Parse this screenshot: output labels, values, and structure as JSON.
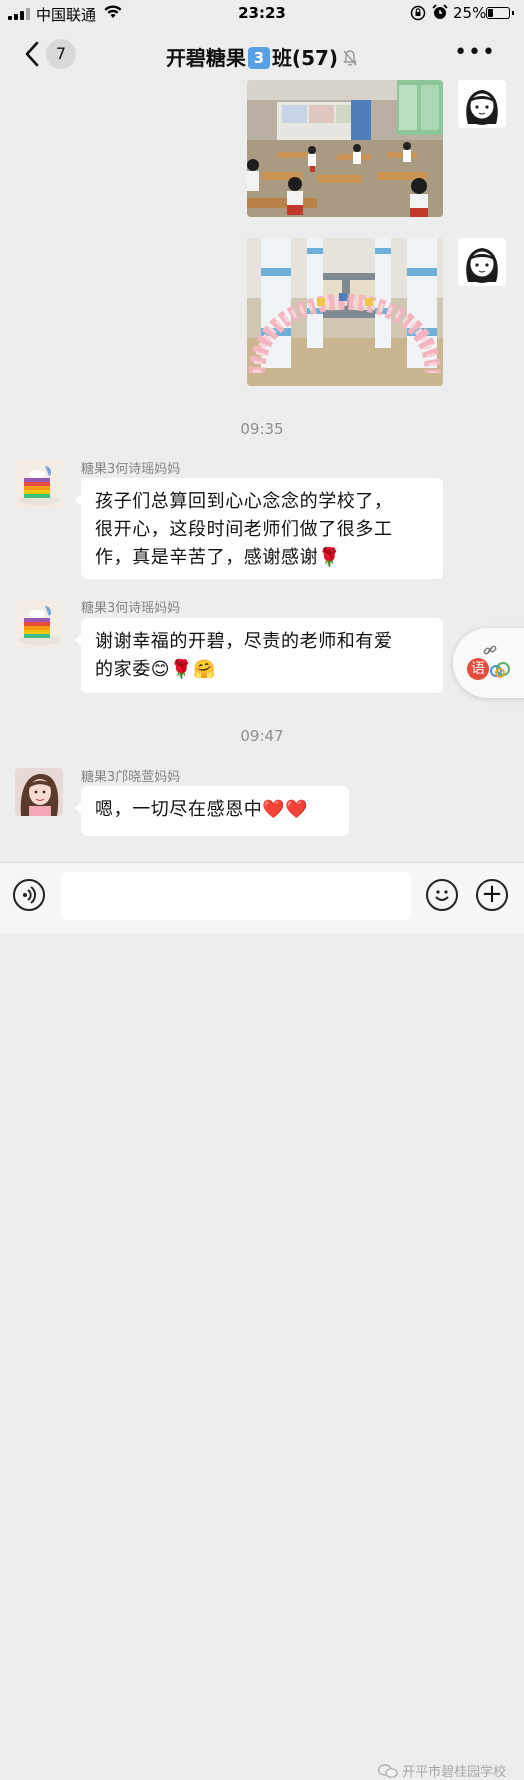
{
  "status_bar": {
    "carrier": "中国联通",
    "time": "23:23",
    "battery": "25%",
    "battery_level": 0.25
  },
  "nav": {
    "back_count": "7",
    "title_prefix": "开碧糖果",
    "title_keycap": "3",
    "title_suffix": "班(57)",
    "more_label": "•••"
  },
  "messages": [
    {
      "type": "image",
      "from": "me",
      "subject": "classroom"
    },
    {
      "type": "image",
      "from": "me",
      "subject": "balloon-arch"
    },
    {
      "type": "time",
      "text": "09:35"
    },
    {
      "type": "text",
      "sender": "糖果3何诗瑶妈妈",
      "lines": [
        "孩子们总算回到心心念念的学校了，",
        "很开心，这段时间老师们做了很多工",
        "作，真是辛苦了，感谢感谢🌹"
      ]
    },
    {
      "type": "text",
      "sender": "糖果3何诗瑶妈妈",
      "lines": [
        "谢谢幸福的开碧，尽责的老师和有爱",
        "的家委😊🌹🤗"
      ]
    },
    {
      "type": "time",
      "text": "09:47"
    },
    {
      "type": "text",
      "sender": "糖果3邝晓萱妈妈",
      "lines": [
        "嗯，一切尽在感恩中❤️❤️"
      ]
    }
  ],
  "float_button": {
    "label": "语"
  },
  "watermark": "开平市碧桂园学校",
  "colors": {
    "background": "#ededed",
    "bubble": "#ffffff",
    "timestamp": "#8f8f8f",
    "keycap": "#5aa0e6"
  }
}
